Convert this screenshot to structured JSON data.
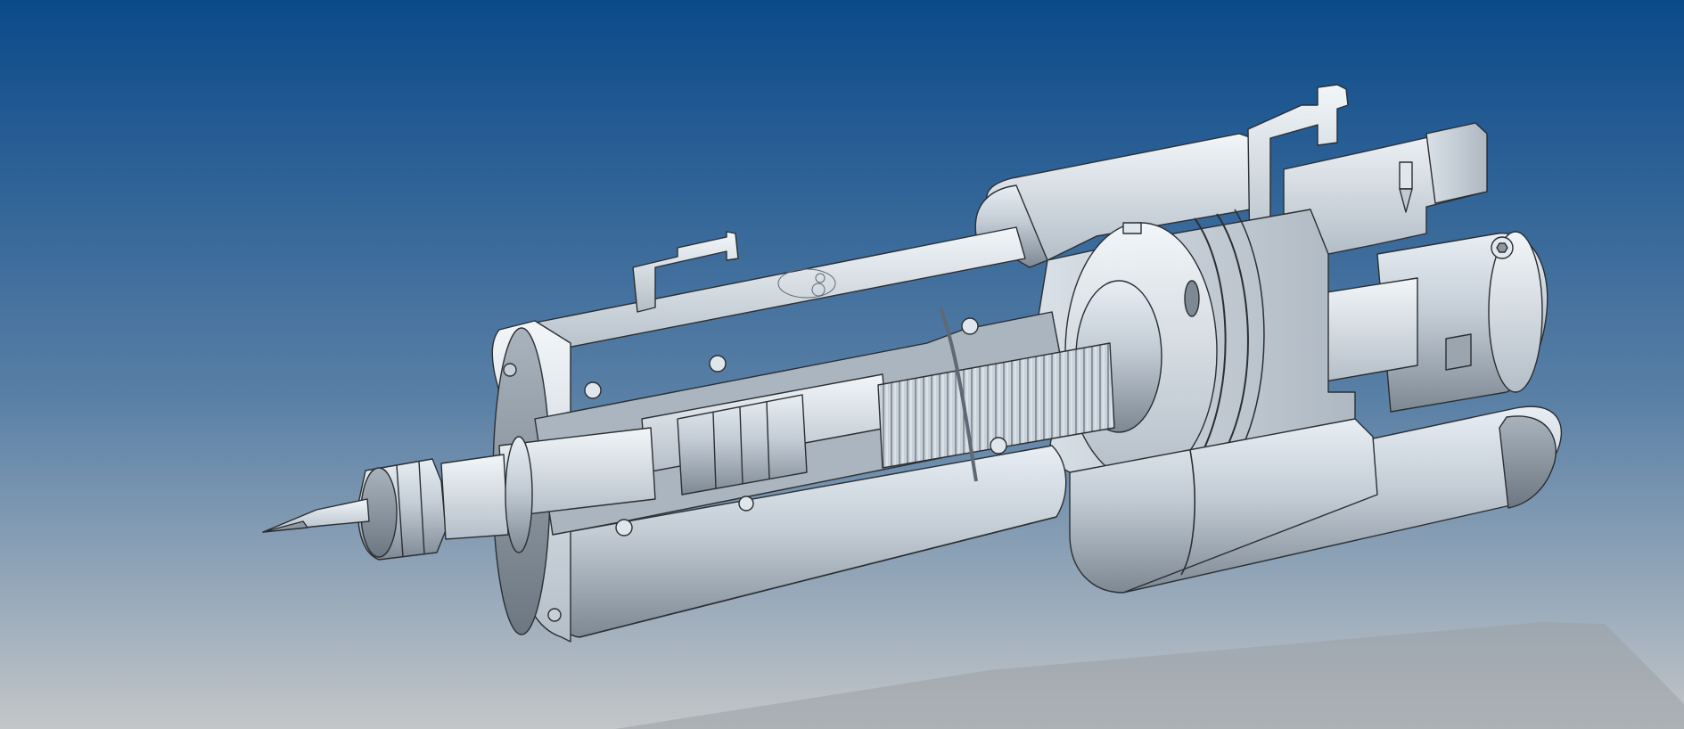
{
  "scene": {
    "type": "cad-3d-section-view",
    "background": {
      "top_color": "#0b4a8a",
      "mid_color": "#4f79a3",
      "bottom_color": "#c3c6c8"
    },
    "model": {
      "name": "spindle-assembly-cutaway",
      "body_color": "#b8c2cc",
      "highlight_color": "#e6edf3",
      "shadow_color": "#7b8793",
      "edge_color": "#2b2f33"
    },
    "ground_shadow_color": "#9aa0a5"
  }
}
